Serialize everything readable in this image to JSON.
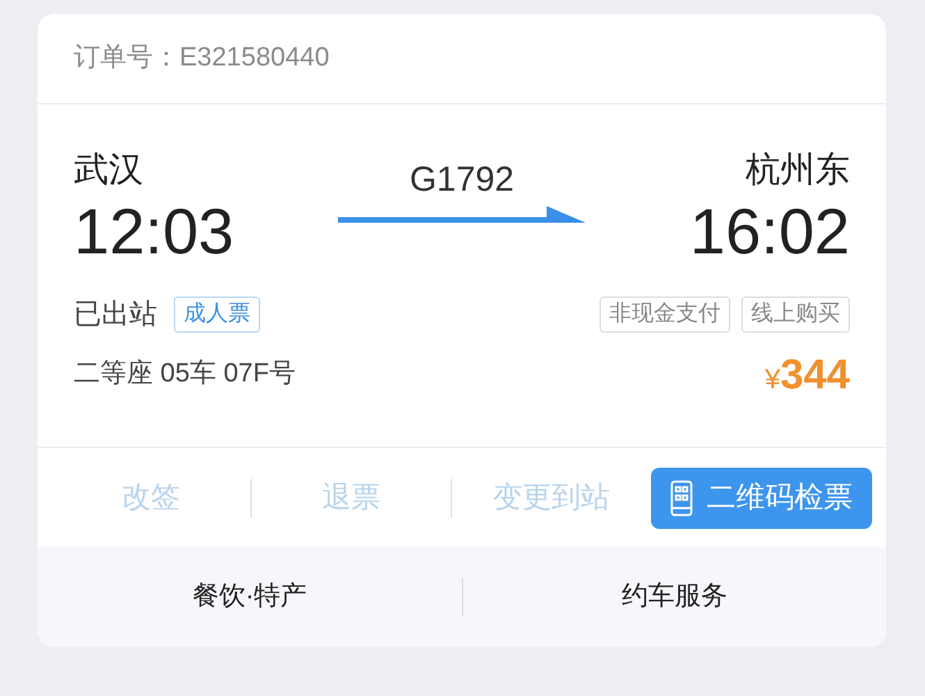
{
  "order": {
    "label": "订单号：",
    "number": "E321580440"
  },
  "departure": {
    "station": "武汉",
    "time": "12:03"
  },
  "train": "G1792",
  "arrival": {
    "station": "杭州东",
    "time": "16:02"
  },
  "status": "已出站",
  "ticket_type": "成人票",
  "tags": [
    "非现金支付",
    "线上购买"
  ],
  "seat": "二等座 05车 07F号",
  "price": {
    "currency": "¥",
    "amount": "344"
  },
  "actions": [
    {
      "label": "改签",
      "kind": "link",
      "disabled": true
    },
    {
      "label": "退票",
      "kind": "link",
      "disabled": true
    },
    {
      "label": "变更到站",
      "kind": "link",
      "disabled": true
    },
    {
      "label": "二维码检票",
      "kind": "primary",
      "disabled": false
    }
  ],
  "services": [
    "餐饮·特产",
    "约车服务"
  ]
}
